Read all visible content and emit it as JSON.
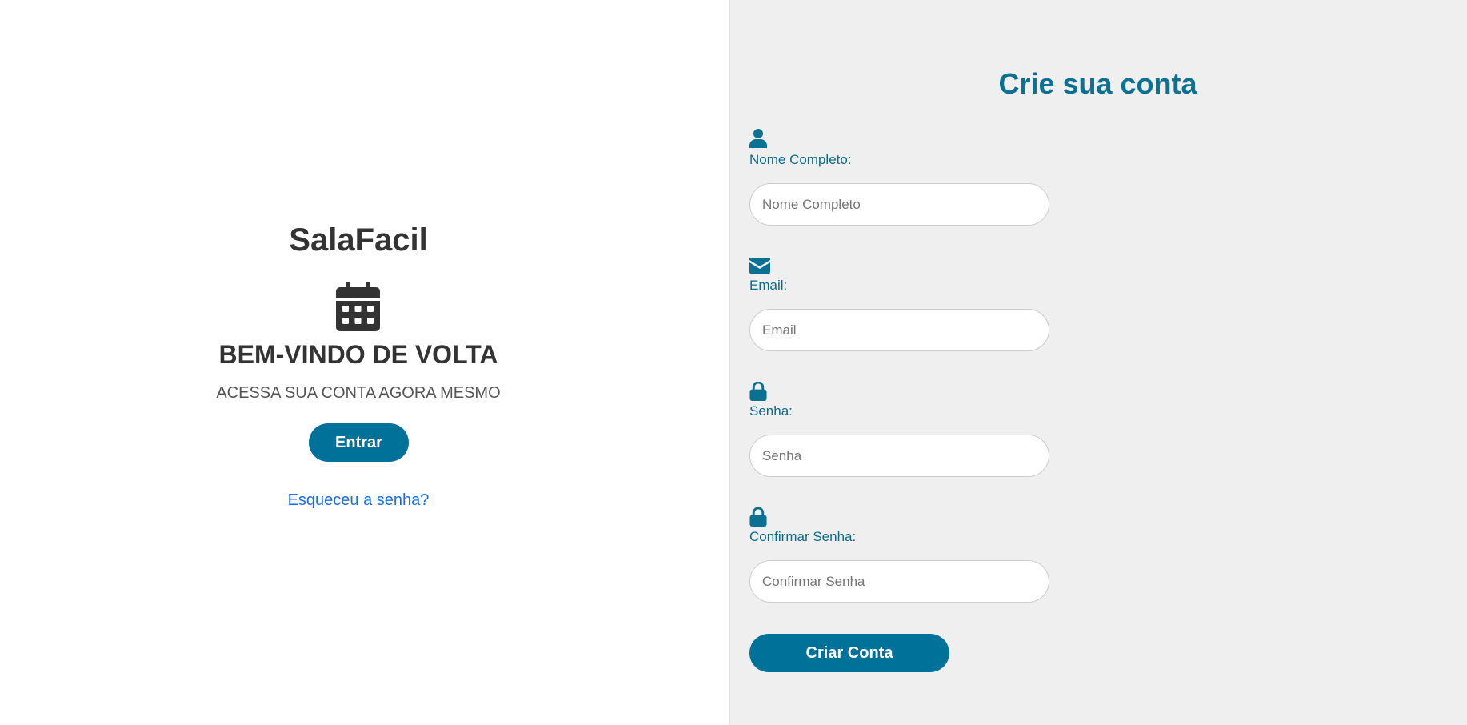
{
  "left": {
    "brand": "SalaFacil",
    "calendar_icon": "calendar-icon",
    "welcome_title": "BEM-VINDO DE VOLTA",
    "welcome_subtitle": "ACESSA SUA CONTA AGORA MESMO",
    "login_button": "Entrar",
    "forgot_link": "Esqueceu a senha?"
  },
  "signup": {
    "title": "Crie sua conta",
    "fields": [
      {
        "icon": "user-icon",
        "label": "Nome Completo:",
        "placeholder": "Nome Completo",
        "value": ""
      },
      {
        "icon": "envelope-icon",
        "label": "Email:",
        "placeholder": "Email",
        "value": ""
      },
      {
        "icon": "lock-icon",
        "label": "Senha:",
        "placeholder": "Senha",
        "value": ""
      },
      {
        "icon": "lock-icon",
        "label": "Confirmar Senha:",
        "placeholder": "Confirmar Senha",
        "value": ""
      }
    ],
    "submit_button": "Criar Conta"
  },
  "colors": {
    "primary": "#00729a",
    "heading_text": "#333333",
    "link": "#1d6fe0",
    "right_background": "#efefef"
  }
}
